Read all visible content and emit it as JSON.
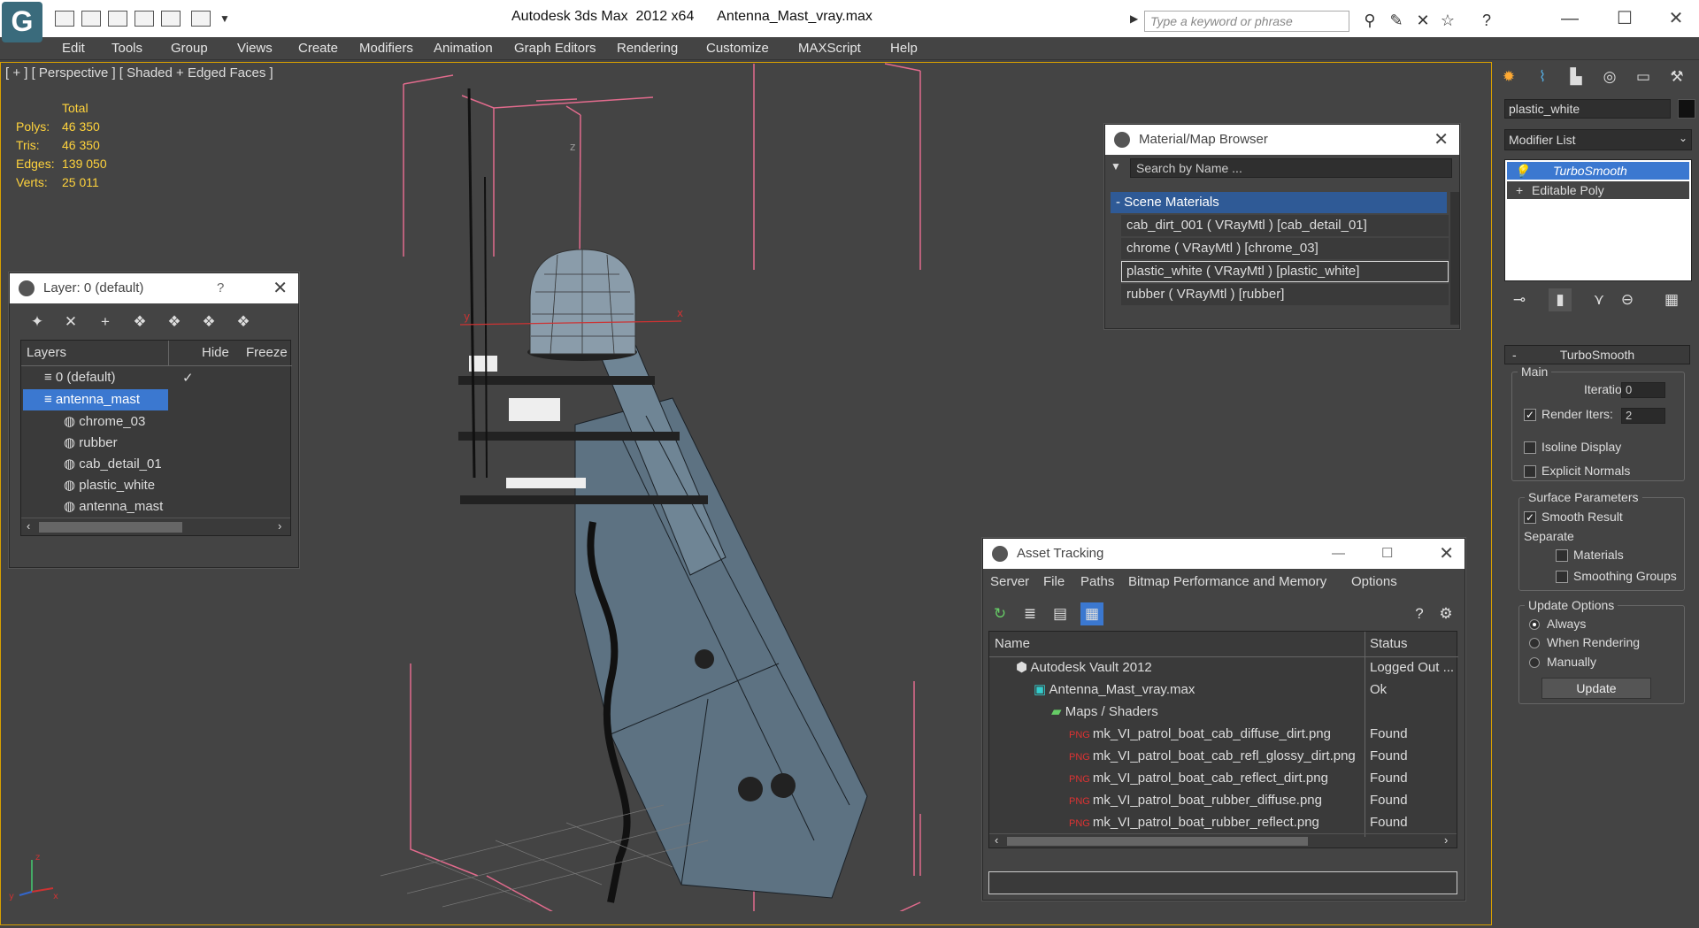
{
  "app": {
    "logo": "G",
    "title": "Autodesk 3ds Max  2012 x64      Antenna_Mast_vray.max"
  },
  "search": {
    "placeholder": "Type a keyword or phrase"
  },
  "menu": [
    "Edit",
    "Tools",
    "Group",
    "Views",
    "Create",
    "Modifiers",
    "Animation",
    "Graph Editors",
    "Rendering",
    "Customize",
    "MAXScript",
    "Help"
  ],
  "viewport": {
    "label": "[ + ] [ Perspective ] [ Shaded + Edged Faces ]",
    "stats": {
      "header": "Total",
      "rows": [
        {
          "label": "Polys:",
          "value": "46 350"
        },
        {
          "label": "Tris:",
          "value": "46 350"
        },
        {
          "label": "Edges:",
          "value": "139 050"
        },
        {
          "label": "Verts:",
          "value": "25 011"
        }
      ]
    },
    "axes": {
      "z": "z",
      "x": "x",
      "y": "y"
    }
  },
  "layer_panel": {
    "title": "Layer: 0 (default)",
    "help": "?",
    "columns": {
      "layers": "Layers",
      "hide": "Hide",
      "freeze": "Freeze"
    },
    "rows": [
      "0 (default)",
      "antenna_mast",
      "chrome_03",
      "rubber",
      "cab_detail_01",
      "plastic_white",
      "antenna_mast"
    ]
  },
  "material_browser": {
    "title": "Material/Map Browser",
    "search_placeholder": "Search by Name ...",
    "section": "- Scene Materials",
    "items": [
      "cab_dirt_001  ( VRayMtl ) [cab_detail_01]",
      "chrome  ( VRayMtl ) [chrome_03]",
      "plastic_white  ( VRayMtl ) [plastic_white]",
      "rubber  ( VRayMtl ) [rubber]"
    ]
  },
  "asset_tracking": {
    "title": "Asset Tracking",
    "menu": [
      "Server",
      "File",
      "Paths",
      "Bitmap Performance and Memory",
      "Options"
    ],
    "columns": {
      "name": "Name",
      "status": "Status"
    },
    "rows": [
      {
        "name": "Autodesk Vault 2012",
        "status": "Logged Out ..."
      },
      {
        "name": "Antenna_Mast_vray.max",
        "status": "Ok"
      },
      {
        "name": "Maps / Shaders",
        "status": ""
      },
      {
        "name": "mk_VI_patrol_boat_cab_diffuse_dirt.png",
        "status": "Found"
      },
      {
        "name": "mk_VI_patrol_boat_cab_refl_glossy_dirt.png",
        "status": "Found"
      },
      {
        "name": "mk_VI_patrol_boat_cab_reflect_dirt.png",
        "status": "Found"
      },
      {
        "name": "mk_VI_patrol_boat_rubber_diffuse.png",
        "status": "Found"
      },
      {
        "name": "mk_VI_patrol_boat_rubber_reflect.png",
        "status": "Found"
      }
    ]
  },
  "command_panel": {
    "object_name": "plastic_white",
    "modifier_list": "Modifier List",
    "stack": [
      "TurboSmooth",
      "Editable Poly"
    ],
    "rollout_title": "TurboSmooth",
    "main": {
      "label": "Main",
      "iterations_label": "Iterations:",
      "iterations": "0",
      "render_iters_label": "Render Iters:",
      "render_iters": "2",
      "isoline": "Isoline Display",
      "explicit": "Explicit Normals"
    },
    "surface": {
      "label": "Surface Parameters",
      "smooth_result": "Smooth Result",
      "separate": "Separate",
      "materials": "Materials",
      "smoothing_groups": "Smoothing Groups"
    },
    "update": {
      "label": "Update Options",
      "always": "Always",
      "when_rendering": "When Rendering",
      "manually": "Manually",
      "button": "Update"
    }
  }
}
